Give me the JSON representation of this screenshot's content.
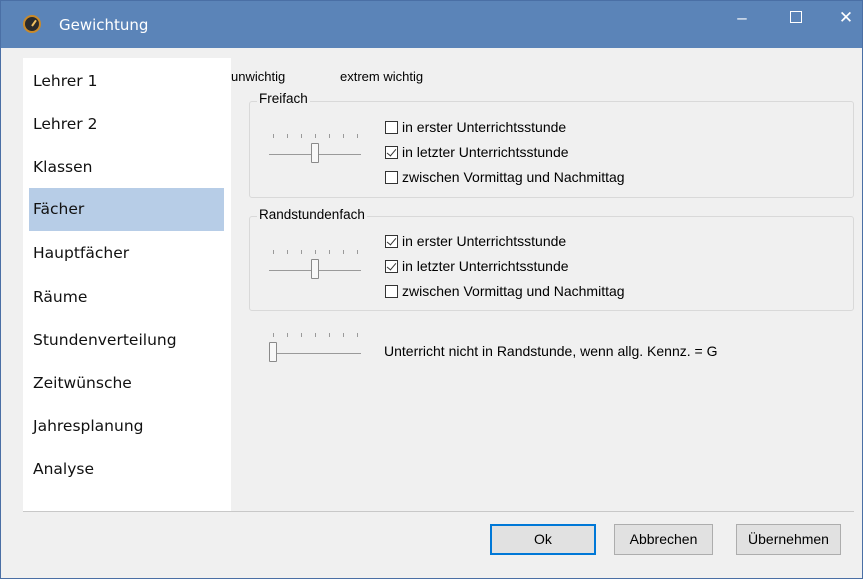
{
  "window": {
    "title": "Gewichtung",
    "minimize_glyph": "‒",
    "close_glyph": "✕",
    "icon": "clock-app-icon"
  },
  "sidebar": {
    "items": [
      {
        "label": "Lehrer 1"
      },
      {
        "label": "Lehrer 2"
      },
      {
        "label": "Klassen"
      },
      {
        "label": "Fächer",
        "selected": true
      },
      {
        "label": "Hauptfächer"
      },
      {
        "label": "Räume"
      },
      {
        "label": "Stundenverteilung"
      },
      {
        "label": "Zeitwünsche"
      },
      {
        "label": "Jahresplanung"
      },
      {
        "label": "Analyse"
      }
    ],
    "selected_color": "#b7cde7"
  },
  "scale": {
    "low_label": "unwichtig",
    "high_label": "extrem wichtig"
  },
  "freifach": {
    "title": "Freifach",
    "slider_level": 0.5,
    "options": [
      {
        "label": "in erster Unterrichtsstunde",
        "checked": false
      },
      {
        "label": "in letzter Unterrichtsstunde",
        "checked": true
      },
      {
        "label": "zwischen Vormittag und Nachmittag",
        "checked": false
      }
    ]
  },
  "randstundenfach": {
    "title": "Randstundenfach",
    "slider_level": 0.5,
    "options": [
      {
        "label": "in erster Unterrichtsstunde",
        "checked": true
      },
      {
        "label": "in letzter Unterrichtsstunde",
        "checked": true
      },
      {
        "label": "zwischen Vormittag und Nachmittag",
        "checked": false
      }
    ]
  },
  "extra": {
    "slider_level": 0.0,
    "label": "Unterricht nicht in Randstunde, wenn allg. Kennz. = G"
  },
  "buttons": {
    "ok": "Ok",
    "cancel": "Abbrechen",
    "apply": "Übernehmen"
  },
  "colors": {
    "titlebar": "#5b84b8",
    "default_button_border": "#0078d7"
  }
}
